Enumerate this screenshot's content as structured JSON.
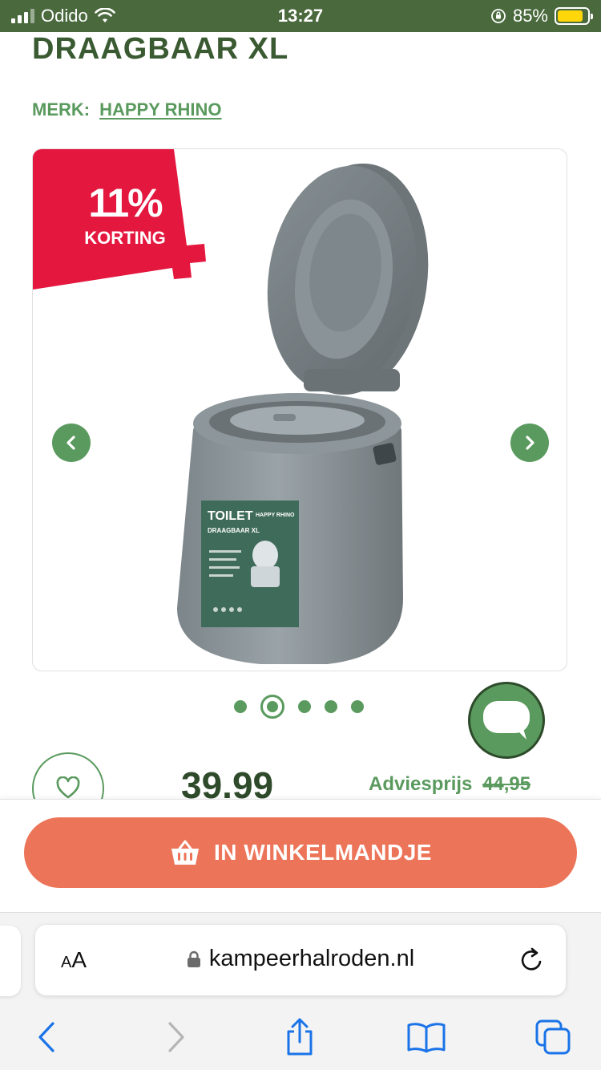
{
  "status_bar": {
    "carrier": "Odido",
    "time": "13:27",
    "battery": "85%",
    "battery_level": 0.85,
    "battery_color": "#ffd60a"
  },
  "product": {
    "title": "DRAAGBAAR XL",
    "brand_label": "MERK:",
    "brand_name": "HAPPY RHINO"
  },
  "badge": {
    "percent": "11%",
    "text": "KORTING",
    "color": "#e4173f"
  },
  "gallery": {
    "prev_icon": "chevron-left-icon",
    "next_icon": "chevron-right-icon",
    "dots": 5,
    "active_dot": 1,
    "package": {
      "title": "TOILET",
      "subtitle": "DRAAGBAAR XL",
      "brand": "HAPPY RHINO"
    }
  },
  "pricing": {
    "price": "39.99",
    "advies_label": "Adviesprijs",
    "advies_price": "44,95"
  },
  "cart": {
    "label": "IN WINKELMANDJE",
    "icon": "basket-icon",
    "color": "#ec7458"
  },
  "browser": {
    "aa_label": "AA",
    "url": "kampeerhalroden.nl",
    "lock_icon": "lock-icon",
    "reload_icon": "reload-icon",
    "toolbar": [
      "back-icon",
      "forward-icon",
      "share-icon",
      "bookmarks-icon",
      "tabs-icon"
    ]
  },
  "colors": {
    "accent_green": "#5a9a5e",
    "dark_green": "#3a5a32",
    "status_bg": "#4a6a3e",
    "ios_blue": "#1a73e8"
  }
}
